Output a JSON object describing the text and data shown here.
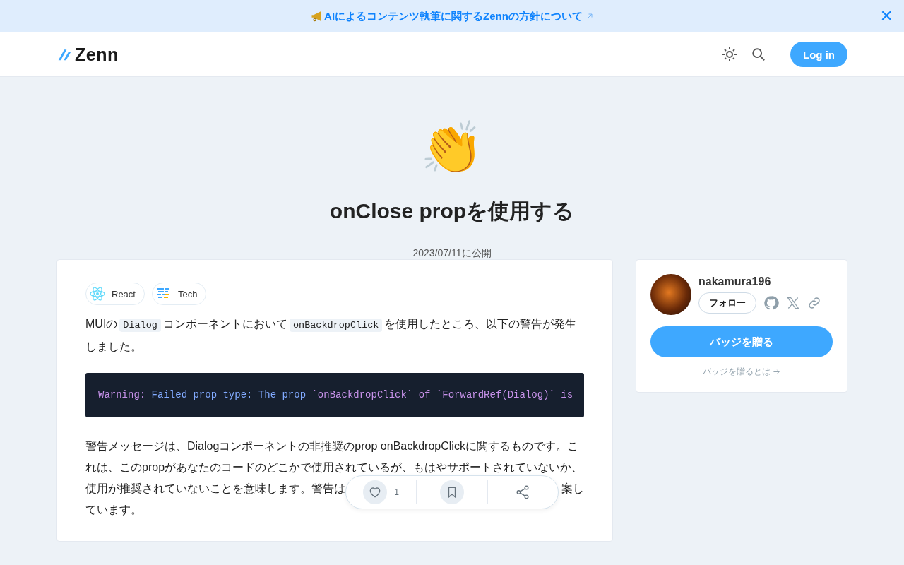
{
  "banner": {
    "text": "AIによるコンテンツ執筆に関するZennの方針について",
    "close": "×"
  },
  "header": {
    "logo": "Zenn",
    "login": "Log in"
  },
  "article": {
    "emoji": "👏",
    "title": "onClose propを使用する",
    "published": "2023/07/11に公開"
  },
  "topics": [
    {
      "label": "React",
      "kind": "react"
    },
    {
      "label": "Tech",
      "kind": "tech"
    }
  ],
  "paragraph_1": [
    {
      "text": "MUIの",
      "kind": "text"
    },
    {
      "text": "Dialog",
      "kind": "code"
    },
    {
      "text": "コンポーネントにおいて",
      "kind": "text"
    },
    {
      "text": "onBackdropClick",
      "kind": "code"
    },
    {
      "text": "を使用したところ、以下の警告が発生しました。",
      "kind": "text"
    }
  ],
  "code_block": [
    {
      "text": "Warning:",
      "kind": "keyword"
    },
    {
      "text": " Failed prop type: The prop ",
      "kind": "plain"
    },
    {
      "text": "`onBackdropClick`",
      "kind": "string"
    },
    {
      "text": " of ",
      "kind": "keyword"
    },
    {
      "text": "`ForwardRef(Dialog)`",
      "kind": "string"
    },
    {
      "text": " is",
      "kind": "keyword"
    }
  ],
  "paragraph_2": {
    "lines": [
      "警告メッセージは、Dialogコンポーネントの非推奨のprop onBackdropClickに関するものです。こ",
      "れは、このpropがあなたのコードのどこかで使用されているが、もはやサポートされていないか、",
      "使用が推奨されていないことを意味します。警告は",
      "ています。"
    ],
    "line_3_tail": "案し"
  },
  "actions": {
    "likes": "1"
  },
  "author": {
    "name": "nakamura196",
    "follow": "フォロー",
    "badge_button": "バッジを贈る",
    "badge_link": "バッジを贈るとは"
  }
}
